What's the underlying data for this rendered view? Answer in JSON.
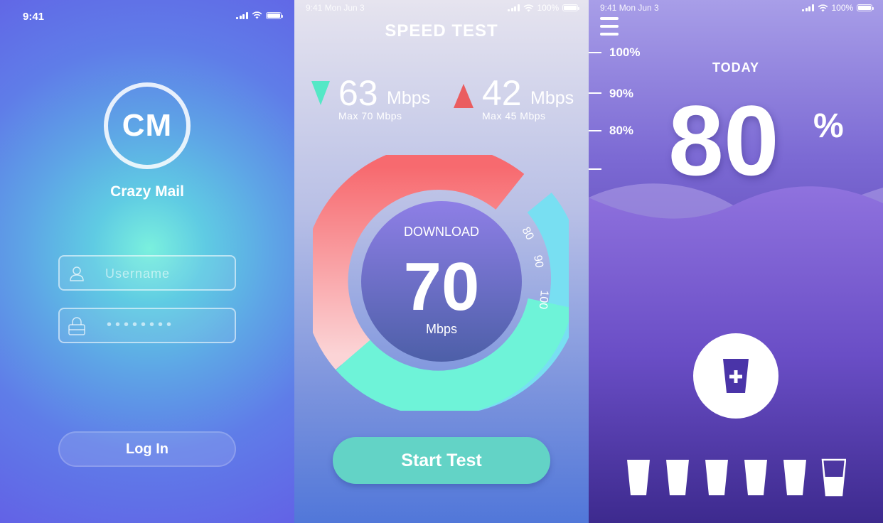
{
  "login": {
    "status_time": "9:41",
    "logo_text": "CM",
    "app_name": "Crazy Mail",
    "username_placeholder": "Username",
    "password_mask": "••••••••",
    "login_label": "Log In"
  },
  "speed": {
    "status_text": "9:41 Mon Jun 3",
    "battery": "100%",
    "title": "SPEED TEST",
    "download": {
      "value": "63",
      "unit": "Mbps",
      "max": "Max 70 Mbps",
      "color": "#54e8c6"
    },
    "upload": {
      "value": "42",
      "unit": "Mbps",
      "max": "Max 45 Mbps",
      "color": "#ea5d60"
    },
    "gauge": {
      "label": "DOWNLOAD",
      "value": "70",
      "unit": "Mbps",
      "ticks": [
        "80",
        "90",
        "100"
      ],
      "hot_color": "#f76e72",
      "cool_color": "#6ef3d8",
      "track_color": "#78dff2"
    },
    "start_label": "Start Test"
  },
  "water": {
    "status_text": "9:41 Mon Jun 3",
    "battery": "100%",
    "ruler_labels": [
      "100%",
      "90%",
      "80%"
    ],
    "today_label": "TODAY",
    "percent_value": "80",
    "percent_sign": "%",
    "cups_total": 6,
    "cups_full": 5,
    "accent": "#4a34a8"
  }
}
